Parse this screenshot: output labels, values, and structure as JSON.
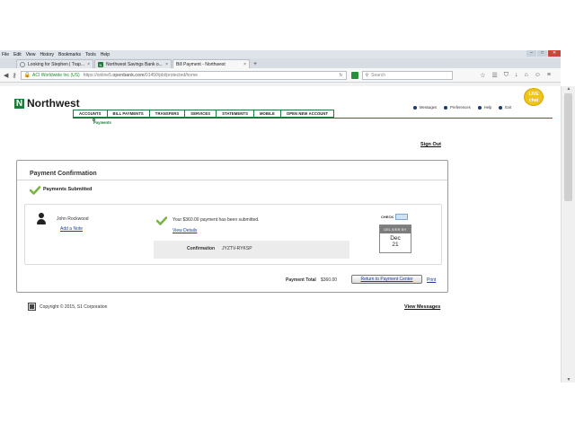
{
  "browser": {
    "menu": [
      "File",
      "Edit",
      "View",
      "History",
      "Bookmarks",
      "Tools",
      "Help"
    ],
    "tabs": [
      {
        "label": "Looking for Stephen | Trap...",
        "close": "×"
      },
      {
        "label": "Northwest Savings Bank o...",
        "close": "×"
      },
      {
        "label": "Bill Payment - Northwest",
        "close": "×"
      }
    ],
    "new_tab": "+",
    "url_ev": "ACI Worldwide Inc (US)",
    "url_prefix": "https://online5.",
    "url_host": "openbank.com",
    "url_path": "/01450/pbi/protected/home",
    "search_placeholder": "Search"
  },
  "brand": {
    "mark": "N",
    "name": "Northwest",
    "green": "#1e7b3c"
  },
  "nav": [
    "ACCOUNTS",
    "BILL PAYMENTS",
    "TRANSFERS",
    "SERVICES",
    "STATEMENTS",
    "MOBILE",
    "OPEN NEW ACCOUNT"
  ],
  "subnav": "Payments",
  "utility": [
    "Messages",
    "Preferences",
    "Help",
    "Exit"
  ],
  "livechat": {
    "line1": "LIVE",
    "line2": "chat"
  },
  "sign_out": "Sign Out",
  "confirmation": {
    "title": "Payment Confirmation",
    "submitted": "Payments Submitted",
    "payee": "John Rockwood",
    "add_note": "Add a Note",
    "message": "Your $360.00 payment has been submitted.",
    "view_details": "View Details",
    "confirmation_label": "Confirmation",
    "confirmation_number": "JYZTV-RYKSP",
    "check_label": "CHECK",
    "deliver_label": "DELIVER BY",
    "deliver_month": "Dec",
    "deliver_day": "21",
    "total_label": "Payment Total",
    "total_value": "$360.00",
    "return_button": "Return to Payment Center",
    "print": "Print"
  },
  "footer": {
    "copyright": "Copyright © 2015, S1 Corporation",
    "view_messages": "View Messages"
  }
}
